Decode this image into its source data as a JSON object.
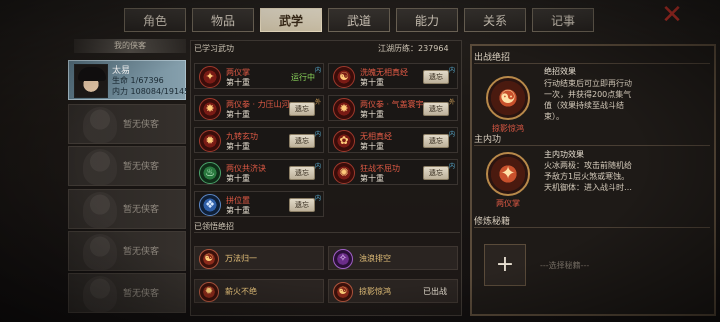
{
  "tabs": [
    {
      "label": "角色",
      "active": false
    },
    {
      "label": "物品",
      "active": false
    },
    {
      "label": "武学",
      "active": true
    },
    {
      "label": "武道",
      "active": false
    },
    {
      "label": "能力",
      "active": false
    },
    {
      "label": "关系",
      "active": false
    },
    {
      "label": "记事",
      "active": false
    }
  ],
  "close_label": "✕",
  "left": {
    "header": "我的侠客",
    "character": {
      "name": "太易",
      "hp_label": "生命 1/67396",
      "mp_label": "内力 108084/191456"
    },
    "empty_label": "暂无侠客",
    "empty_count": 5
  },
  "middle": {
    "learned_title": "已学习武功",
    "jianghu_label": "江湖历练：237964",
    "skills": [
      {
        "name": "两仪掌",
        "level": "第十重",
        "action": "运行中",
        "running": true,
        "tag": "内",
        "icon": "✦",
        "variant": "red"
      },
      {
        "name": "洗魄无相真经",
        "level": "第十重",
        "action": "遗忘",
        "running": false,
        "tag": "内",
        "icon": "☯",
        "variant": "red"
      },
      {
        "name": "两仪拳 · 力压山河",
        "level": "第十重",
        "action": "遗忘",
        "running": false,
        "tag": "外",
        "icon": "✸",
        "variant": "red"
      },
      {
        "name": "两仪拳 · 气盖寰宇",
        "level": "第十重",
        "action": "遗忘",
        "running": false,
        "tag": "外",
        "icon": "✸",
        "variant": "red"
      },
      {
        "name": "九转玄功",
        "level": "第十重",
        "action": "遗忘",
        "running": false,
        "tag": "内",
        "icon": "✹",
        "variant": "red"
      },
      {
        "name": "无相真经",
        "level": "第十重",
        "action": "遗忘",
        "running": false,
        "tag": "内",
        "icon": "✿",
        "variant": "red"
      },
      {
        "name": "两仪共济诀",
        "level": "第十重",
        "action": "遗忘",
        "running": false,
        "tag": "内",
        "icon": "♨",
        "variant": "white"
      },
      {
        "name": "狂战不屈功",
        "level": "第十重",
        "action": "遗忘",
        "running": false,
        "tag": "内",
        "icon": "✺",
        "variant": "red"
      },
      {
        "name": "拼位置",
        "level": "第十重",
        "action": "遗忘",
        "running": false,
        "tag": "内",
        "icon": "❖",
        "variant": "blue"
      }
    ],
    "ult_title": "已领悟绝招",
    "ults": [
      {
        "name": "万法归一",
        "status": "",
        "icon": "☯",
        "variant": "red"
      },
      {
        "name": "浊浪排空",
        "status": "",
        "icon": "✧",
        "variant": "purple"
      },
      {
        "name": "薪火不绝",
        "status": "",
        "icon": "✹",
        "variant": "red"
      },
      {
        "name": "掠影惊鸿",
        "status": "已出战",
        "icon": "☯",
        "variant": "red"
      }
    ]
  },
  "right": {
    "battle_title": "出战绝招",
    "battle_orb_icon": "☯",
    "battle_orb_label": "掠影惊鸿",
    "battle_desc_title": "绝招效果",
    "battle_desc": "行动结束后可立即再行动一次，并获得200点集气值（效果持续至战斗结束）。",
    "inner_title": "主内功",
    "inner_orb_icon": "✦",
    "inner_orb_label": "两仪掌",
    "inner_desc_title": "主内功效果",
    "inner_desc": "火冰两极：攻击前随机给予敌方1层火煞或寒蚀。天机御体：进入战斗时…",
    "cultivate_title": "修炼秘籍",
    "plus_label": "+",
    "hint": "---选择秘籍---"
  }
}
